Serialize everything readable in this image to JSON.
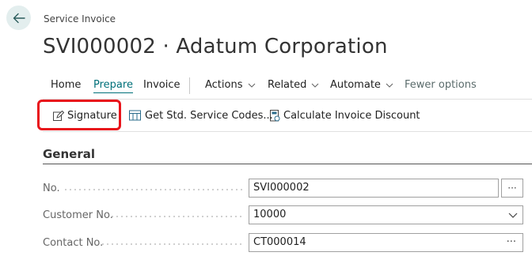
{
  "breadcrumb": "Service Invoice",
  "title": "SVI000002 · Adatum Corporation",
  "tabs": [
    {
      "label": "Home"
    },
    {
      "label": "Prepare"
    },
    {
      "label": "Invoice"
    },
    {
      "label": "Actions"
    },
    {
      "label": "Related"
    },
    {
      "label": "Automate"
    },
    {
      "label": "Fewer options"
    }
  ],
  "actions": [
    {
      "label": "Signature"
    },
    {
      "label": "Get Std. Service Codes..."
    },
    {
      "label": "Calculate Invoice Discount"
    }
  ],
  "general": {
    "title": "General",
    "fields": [
      {
        "label": "No.",
        "value": "SVI000002"
      },
      {
        "label": "Customer No.",
        "value": "10000"
      },
      {
        "label": "Contact No.",
        "value": "CT000014"
      }
    ]
  },
  "colors": {
    "accent": "#00707a",
    "highlight": "#e8141b"
  }
}
